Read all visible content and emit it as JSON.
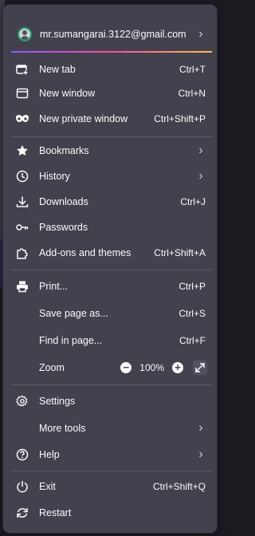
{
  "account": {
    "email": "mr.sumangarai.3122@gmail.com"
  },
  "menu": {
    "new_tab": {
      "label": "New tab",
      "shortcut": "Ctrl+T"
    },
    "new_window": {
      "label": "New window",
      "shortcut": "Ctrl+N"
    },
    "new_private_window": {
      "label": "New private window",
      "shortcut": "Ctrl+Shift+P"
    },
    "bookmarks": {
      "label": "Bookmarks"
    },
    "history": {
      "label": "History"
    },
    "downloads": {
      "label": "Downloads",
      "shortcut": "Ctrl+J"
    },
    "passwords": {
      "label": "Passwords"
    },
    "addons": {
      "label": "Add-ons and themes",
      "shortcut": "Ctrl+Shift+A"
    },
    "print": {
      "label": "Print...",
      "shortcut": "Ctrl+P"
    },
    "save_page": {
      "label": "Save page as...",
      "shortcut": "Ctrl+S"
    },
    "find": {
      "label": "Find in page...",
      "shortcut": "Ctrl+F"
    },
    "zoom": {
      "label": "Zoom",
      "value": "100%",
      "minus": "−",
      "plus": "+"
    },
    "settings": {
      "label": "Settings"
    },
    "more_tools": {
      "label": "More tools"
    },
    "help": {
      "label": "Help"
    },
    "exit": {
      "label": "Exit",
      "shortcut": "Ctrl+Shift+Q"
    },
    "restart": {
      "label": "Restart"
    }
  },
  "icons": {
    "account": "account-avatar-icon",
    "new_tab": "new-tab-icon",
    "new_window": "window-icon",
    "private": "private-mask-icon",
    "bookmarks": "star-icon",
    "history": "clock-icon",
    "downloads": "download-icon",
    "passwords": "key-icon",
    "addons": "puzzle-icon",
    "print": "printer-icon",
    "fullscreen": "fullscreen-icon",
    "settings": "gear-icon",
    "help": "help-icon",
    "exit": "power-icon",
    "restart": "restart-icon"
  },
  "colors": {
    "panel_bg": "#42414d",
    "text": "#fbfbfe",
    "separator": "#5b5a66",
    "accent_gradient": [
      "#9059ff",
      "#ff4aa2",
      "#ffbd4f"
    ]
  }
}
